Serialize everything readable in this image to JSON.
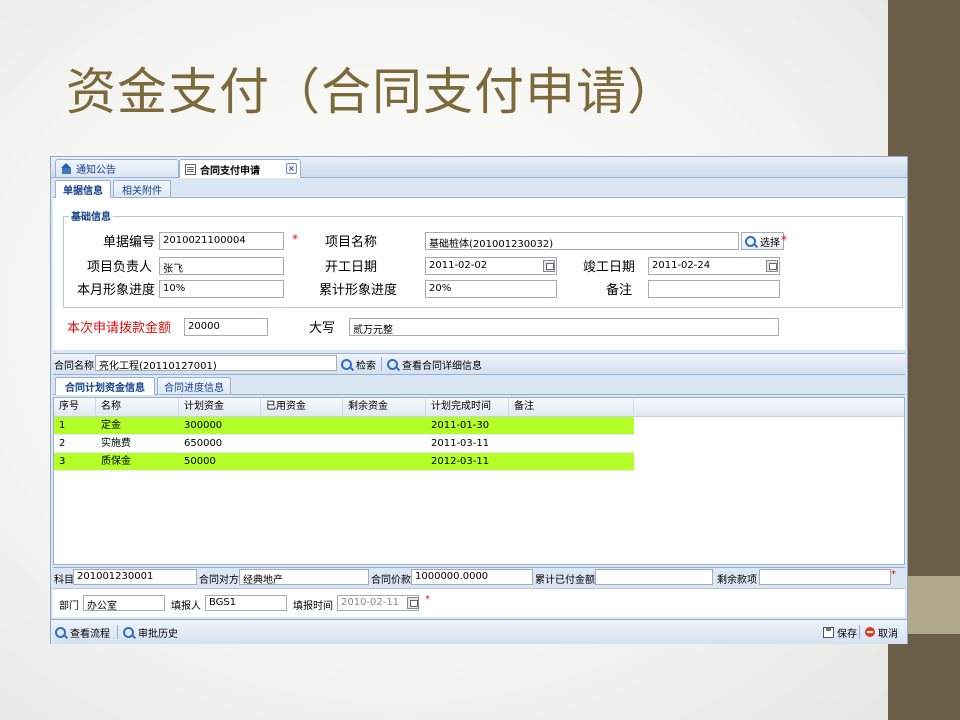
{
  "slide": {
    "title": "资金支付（合同支付申请）"
  },
  "tabs": [
    {
      "label": "通知公告",
      "icon": "home-icon"
    },
    {
      "label": "合同支付申请",
      "icon": "document-icon",
      "close": "×"
    }
  ],
  "subtabs": [
    "单据信息",
    "相关附件"
  ],
  "basic": {
    "legend": "基础信息",
    "doc_no_label": "单据编号",
    "doc_no": "2010021100004",
    "project_name_label": "项目名称",
    "project_name": "基础桩体(201001230032)",
    "select_label": "选择",
    "manager_label": "项目负责人",
    "manager": "张飞",
    "start_date_label": "开工日期",
    "start_date": "2011-02-02",
    "end_date_label": "竣工日期",
    "end_date": "2011-02-24",
    "month_progress_label": "本月形象进度",
    "month_progress": "10%",
    "total_progress_label": "累计形象进度",
    "total_progress": "20%",
    "remark_label": "备注",
    "remark": "",
    "required_mark": "*"
  },
  "amount": {
    "label": "本次申请拨款金额",
    "value": "20000",
    "upper_label": "大写",
    "upper_value": "贰万元整"
  },
  "contract": {
    "name_label": "合同名称",
    "name": "亮化工程(20110127001)",
    "search_label": "检索",
    "detail_label": "查看合同详细信息"
  },
  "grid_tabs": [
    "合同计划资金信息",
    "合同进度信息"
  ],
  "grid": {
    "headers": [
      "序号",
      "名称",
      "计划资金",
      "已用资金",
      "剩余资金",
      "计划完成时间",
      "备注"
    ],
    "rows": [
      {
        "no": "1",
        "name": "定金",
        "plan": "300000",
        "used": "",
        "remain": "",
        "date": "2011-01-30",
        "remark": "",
        "highlight": true
      },
      {
        "no": "2",
        "name": "实施费",
        "plan": "650000",
        "used": "",
        "remain": "",
        "date": "2011-03-11",
        "remark": "",
        "highlight": false
      },
      {
        "no": "3",
        "name": "质保金",
        "plan": "50000",
        "used": "",
        "remain": "",
        "date": "2012-03-11",
        "remark": "",
        "highlight": true
      }
    ]
  },
  "info": {
    "subject_label": "科目",
    "subject": "201001230001",
    "party_label": "合同对方",
    "party": "经典地产",
    "price_label": "合同价款",
    "price": "1000000.0000",
    "paid_label": "累计已付金额",
    "paid": "",
    "remain_label": "剩余款项",
    "remain": ""
  },
  "meta": {
    "dept_label": "部门",
    "dept": "办公室",
    "reporter_label": "填报人",
    "reporter": "BGS1",
    "report_time_label": "填报时间",
    "report_time": "2010-02-11"
  },
  "bottom": {
    "flow_label": "查看流程",
    "history_label": "审批历史",
    "save_label": "保存",
    "cancel_label": "取消"
  }
}
